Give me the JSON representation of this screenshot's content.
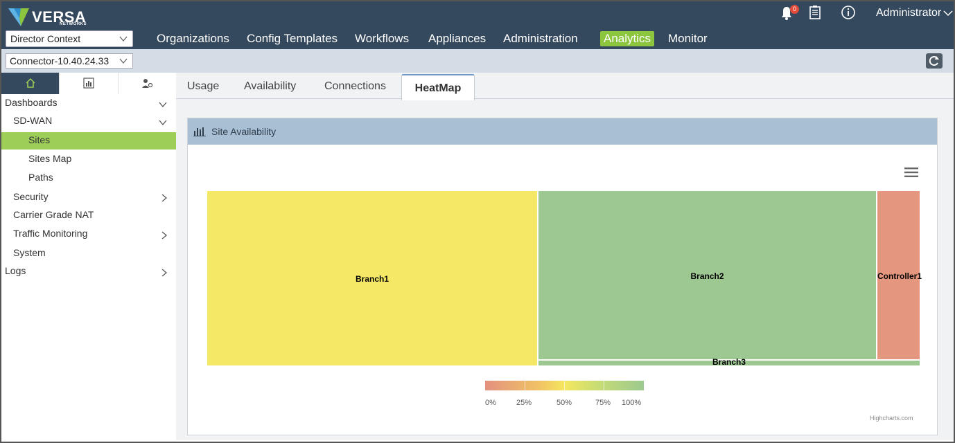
{
  "header": {
    "brand": "VERSA",
    "brand_sub": "NETWORKS",
    "context_select": "Director Context",
    "nav": [
      "Organizations",
      "Config Templates",
      "Workflows",
      "Appliances",
      "Administration",
      "Analytics",
      "Monitor"
    ],
    "active_nav": "Analytics",
    "notification_count": "0",
    "user": "Administrator"
  },
  "subbar": {
    "connector_select": "Connector-10.40.24.33"
  },
  "sidebar": {
    "items": [
      {
        "label": "Dashboards",
        "expanded": true
      },
      {
        "label": "SD-WAN",
        "expanded": true
      },
      {
        "label": "Sites",
        "selected": true
      },
      {
        "label": "Sites Map"
      },
      {
        "label": "Paths"
      },
      {
        "label": "Security"
      },
      {
        "label": "Carrier Grade NAT"
      },
      {
        "label": "Traffic Monitoring"
      },
      {
        "label": "System"
      },
      {
        "label": "Logs"
      }
    ]
  },
  "tabs": [
    "Usage",
    "Availability",
    "Connections",
    "HeatMap"
  ],
  "active_tab": "HeatMap",
  "panel": {
    "title": "Site Availability",
    "credits": "Highcharts.com"
  },
  "colors": {
    "topbar": "#34495e",
    "accent": "#8cc63f",
    "panel_header": "#a8bfd4"
  },
  "chart_data": {
    "type": "heatmap",
    "subtype": "treemap",
    "cells": [
      {
        "name": "Branch1",
        "color": "#f5e866"
      },
      {
        "name": "Branch2",
        "color": "#9dc891"
      },
      {
        "name": "Controller1",
        "color": "#e4967e"
      },
      {
        "name": "Branch3",
        "color": "#9dc891"
      }
    ],
    "color_axis": {
      "labels": [
        "0%",
        "25%",
        "50%",
        "75%",
        "100%"
      ],
      "min": 0,
      "max": 100,
      "stops": [
        "#e3917f",
        "#f5e75f",
        "#9cc98f"
      ]
    }
  }
}
